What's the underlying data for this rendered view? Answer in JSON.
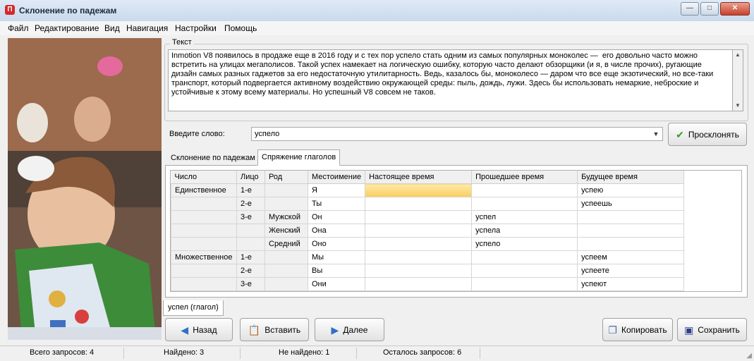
{
  "window": {
    "title": "Склонение по падежам",
    "app_icon": "П",
    "minimize": "—",
    "maximize": "□",
    "close": "✕"
  },
  "menu": [
    "Файл",
    "Редактирование",
    "Вид",
    "Навигация",
    "Настройки",
    "Помощь"
  ],
  "text_group": {
    "legend": "Текст",
    "content": "Inmotion V8 появилось в продаже еще в 2016 году и с тех пор успело стать одним из самых популярных моноколес —  его довольно часто можно\nвстретить на улицах мегаполисов. Такой успех намекает на логическую ошибку, которую часто делают обзорщики (и я, в числе прочих), ругающие\nдизайн самых разных гаджетов за его недостаточную утилитарность. Ведь, казалось бы, моноколесо — даром что все еще экзотический, но все-таки\nтранспорт, который подвергается активному воздействию окружающей среды: пыль, дождь, лужи. Здесь бы использовать немаркие, неброские и\nустойчивые к этому всему материалы. Но успешный V8 совсем не таков."
  },
  "word_input": {
    "label": "Введите слово:",
    "value": "успело"
  },
  "buttons": {
    "decline": "Просклонять",
    "back": "Назад",
    "paste": "Вставить",
    "next": "Далее",
    "copy": "Копировать",
    "save": "Сохранить"
  },
  "tabs": {
    "declension": "Склонение по падежам",
    "conjugation": "Спряжение глаголов"
  },
  "grid": {
    "headers": [
      "Число",
      "Лицо",
      "Род",
      "Местоимение",
      "Настоящее время",
      "Прошедшее время",
      "Будущее время"
    ],
    "rows": [
      [
        "Единственное",
        "1-е",
        "",
        "Я",
        "",
        "",
        "успею"
      ],
      [
        "",
        "2-е",
        "",
        "Ты",
        "",
        "",
        "успеешь"
      ],
      [
        "",
        "3-е",
        "Мужской",
        "Он",
        "",
        "успел",
        ""
      ],
      [
        "",
        "",
        "Женский",
        "Она",
        "",
        "успела",
        ""
      ],
      [
        "",
        "",
        "Средний",
        "Оно",
        "",
        "успело",
        ""
      ],
      [
        "Множественное",
        "1-е",
        "",
        "Мы",
        "",
        "",
        "успеем"
      ],
      [
        "",
        "2-е",
        "",
        "Вы",
        "",
        "",
        "успеете"
      ],
      [
        "",
        "3-е",
        "",
        "Они",
        "",
        "",
        "успеют"
      ]
    ]
  },
  "result_tab": "успел (глагол)",
  "status": {
    "total": "Всего запросов: 4",
    "found": "Найдено: 3",
    "not_found": "Не найдено: 1",
    "remaining": "Осталось запросов: 6"
  }
}
